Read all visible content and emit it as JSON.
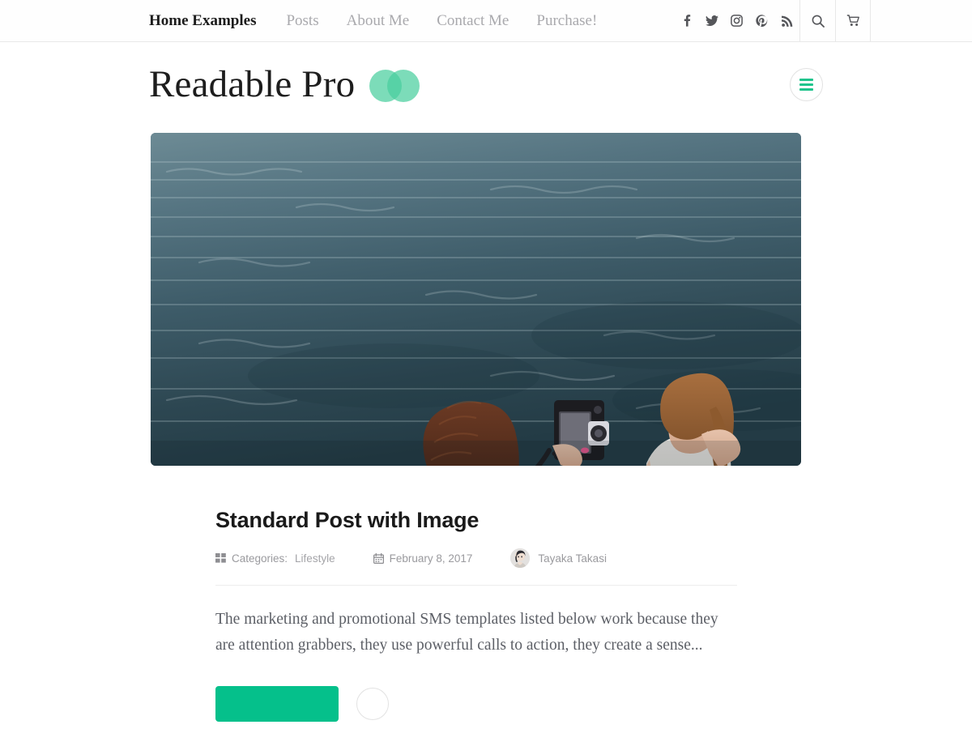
{
  "header": {
    "nav": [
      {
        "label": "Home Examples",
        "active": true
      },
      {
        "label": "Posts",
        "active": false
      },
      {
        "label": "About Me",
        "active": false
      },
      {
        "label": "Contact Me",
        "active": false
      },
      {
        "label": "Purchase!",
        "active": false
      }
    ],
    "social": [
      {
        "name": "facebook-icon",
        "label": "Facebook"
      },
      {
        "name": "twitter-icon",
        "label": "Twitter"
      },
      {
        "name": "instagram-icon",
        "label": "Instagram"
      },
      {
        "name": "pinterest-icon",
        "label": "Pinterest"
      },
      {
        "name": "rss-icon",
        "label": "RSS"
      }
    ],
    "utilities": [
      {
        "name": "search-icon",
        "label": "Search"
      },
      {
        "name": "cart-icon",
        "label": "Cart"
      }
    ]
  },
  "brand": {
    "title": "Readable Pro",
    "logo_color": "#49cf9e",
    "menu_label": "Menu"
  },
  "hero": {
    "alt": "Two women photographing each other on rocks by the sea"
  },
  "post": {
    "title": "Standard Post with Image",
    "meta": {
      "categories_label": "Categories:",
      "categories_value": "Lifestyle",
      "date": "February 8, 2017",
      "author": "Tayaka Takasi"
    },
    "excerpt": "The marketing and promotional SMS templates listed below work because they are attention grabbers, they use powerful calls to action, they create a sense...",
    "read_more_label": "",
    "accent_color": "#05c08b"
  }
}
